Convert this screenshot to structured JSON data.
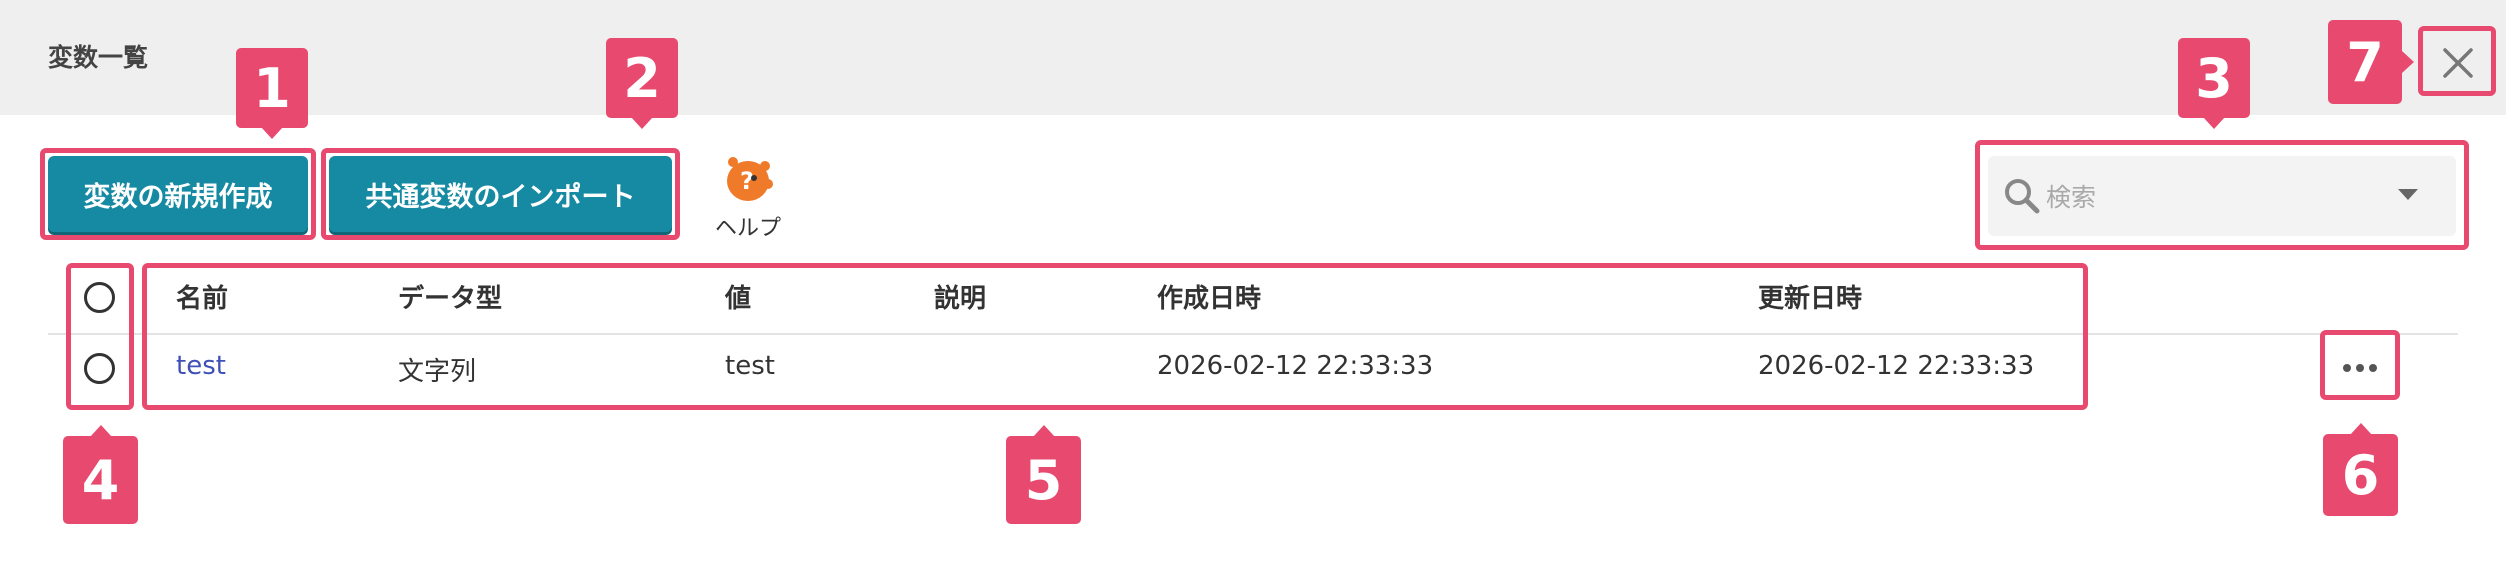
{
  "dialog": {
    "title": "変数一覧",
    "close_icon": "close-icon"
  },
  "toolbar": {
    "new_variable_label": "変数の新規作成",
    "import_common_label": "共通変数のインポート",
    "help_label": "ヘルプ",
    "help_icon": "help-mascot-icon",
    "accent_color": "#168aa2"
  },
  "search": {
    "placeholder": "検索",
    "icon": "search-icon",
    "dropdown_icon": "caret-down-icon"
  },
  "table": {
    "columns": [
      "名前",
      "データ型",
      "値",
      "説明",
      "作成日時",
      "更新日時"
    ],
    "rows": [
      {
        "name": "test",
        "data_type": "文字列",
        "value": "test",
        "description": "",
        "created_at": "2026-02-12 22:33:33",
        "updated_at": "2026-02-12 22:33:33",
        "menu_icon": "more-horizontal-icon"
      }
    ]
  },
  "annotations": {
    "color": "#e84a6f",
    "labels": [
      "1",
      "2",
      "3",
      "4",
      "5",
      "6",
      "7"
    ]
  }
}
